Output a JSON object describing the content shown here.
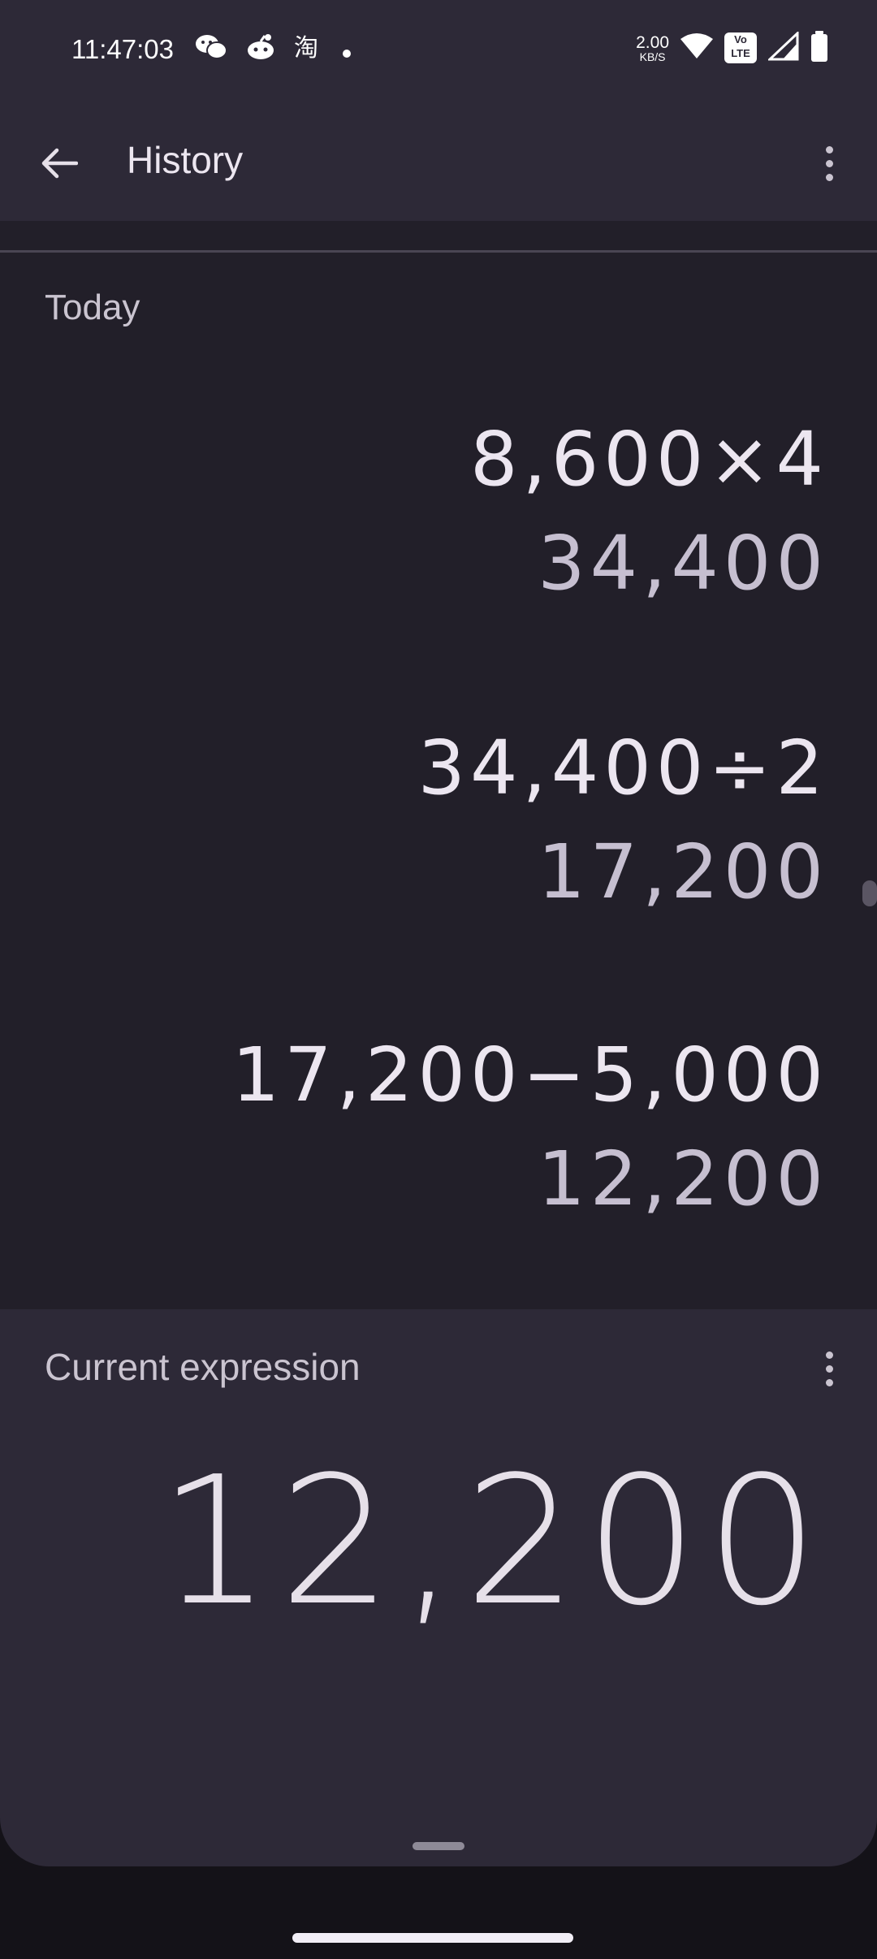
{
  "status_bar": {
    "time": "11:47:03",
    "net_speed_value": "2.00",
    "net_speed_unit": "KB/S",
    "volte_label": "Vo\nLTE",
    "icons": [
      "wechat-icon",
      "reddit-icon",
      "taobao-icon",
      "dot-icon",
      "wifi-icon",
      "volte-icon",
      "signal-icon",
      "battery-icon"
    ]
  },
  "app_bar": {
    "title": "History"
  },
  "history": {
    "section_label": "Today",
    "entries": [
      {
        "expression": "8,600×4",
        "result": "34,400"
      },
      {
        "expression": "34,400÷2",
        "result": "17,200"
      },
      {
        "expression": "17,200−5,000",
        "result": "12,200"
      }
    ]
  },
  "current": {
    "label": "Current expression",
    "value": "12,200"
  },
  "colors": {
    "surface": "#2d2937",
    "history_bg": "#221f29",
    "background": "#141218",
    "text_primary": "#ece6f0",
    "text_secondary": "#cac4d0"
  }
}
